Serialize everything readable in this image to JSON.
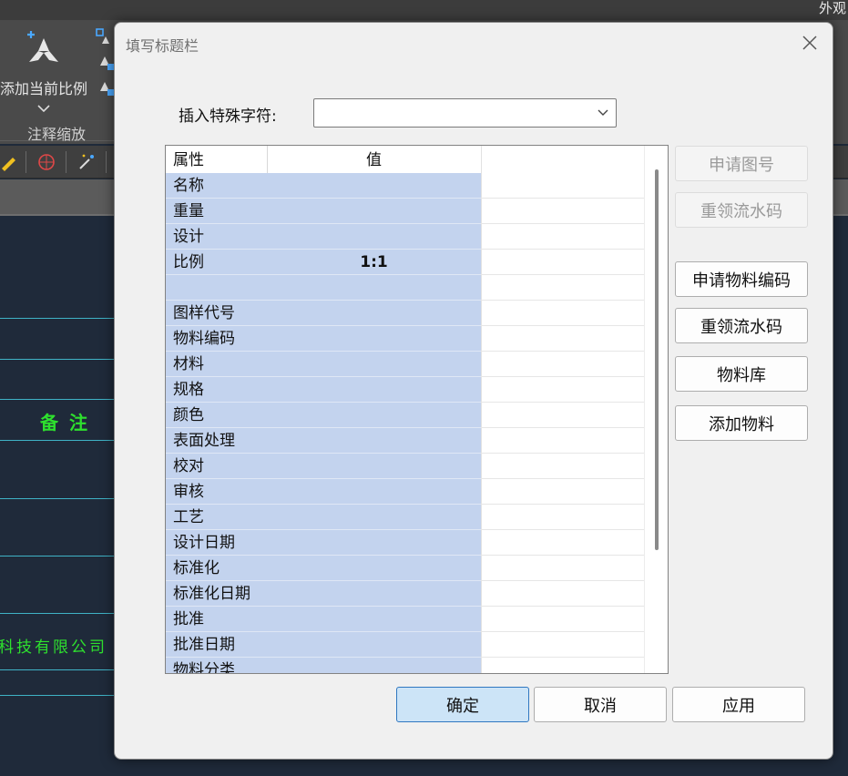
{
  "app": {
    "appearance_menu": "外观",
    "ribbon": {
      "add_scale_label": "添加当前比例",
      "group_title": "注释缩放"
    },
    "drawing": {
      "note_text": "备注",
      "company_text": "科技有限公司"
    }
  },
  "dialog": {
    "title": "填写标题栏",
    "insert_label": "插入特殊字符:",
    "insert_value": "",
    "grid": {
      "headers": {
        "property": "属性",
        "value": "值"
      },
      "rows": [
        {
          "property": "名称",
          "value": ""
        },
        {
          "property": "重量",
          "value": ""
        },
        {
          "property": "设计",
          "value": ""
        },
        {
          "property": "比例",
          "value": "1:1"
        },
        {
          "property": "",
          "value": ""
        },
        {
          "property": "图样代号",
          "value": ""
        },
        {
          "property": "物料编码",
          "value": ""
        },
        {
          "property": "材料",
          "value": ""
        },
        {
          "property": "规格",
          "value": ""
        },
        {
          "property": "颜色",
          "value": ""
        },
        {
          "property": "表面处理",
          "value": ""
        },
        {
          "property": "校对",
          "value": ""
        },
        {
          "property": "审核",
          "value": ""
        },
        {
          "property": "工艺",
          "value": ""
        },
        {
          "property": "设计日期",
          "value": ""
        },
        {
          "property": "标准化",
          "value": ""
        },
        {
          "property": "标准化日期",
          "value": ""
        },
        {
          "property": "批准",
          "value": ""
        },
        {
          "property": "批准日期",
          "value": ""
        },
        {
          "property": "物料分类",
          "value": ""
        }
      ]
    },
    "side_buttons": {
      "apply_drawing_no": "申请图号",
      "reclaim_serial_1": "重领流水码",
      "apply_material_code": "申请物料编码",
      "reclaim_serial_2": "重领流水码",
      "material_library": "物料库",
      "add_material": "添加物料"
    },
    "footer": {
      "ok": "确定",
      "cancel": "取消",
      "apply": "应用"
    }
  }
}
